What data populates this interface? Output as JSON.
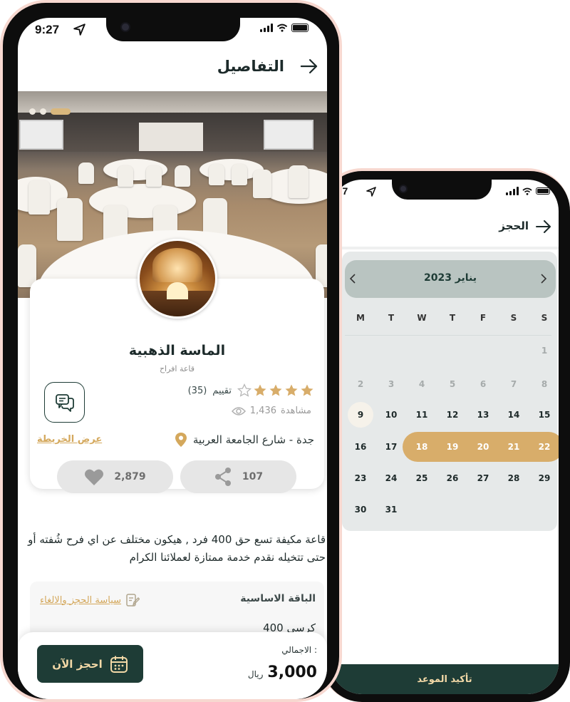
{
  "details_screen": {
    "status_time": "9:27",
    "header_title": "التفاصيل",
    "venue_name": "الماسة الذهبية",
    "venue_type": "قاعة افراح",
    "rating_count": "(35)",
    "rating_label": "تقييم",
    "rating_stars": 4,
    "views": "1,436",
    "views_label": "مشاهدة",
    "location": "جدة - شارع الجامعة العربية",
    "map_link": "عرض الخريطة",
    "likes": "2,879",
    "shares": "107",
    "description": "قاعة مكيفة تسع حق 400 فرد , هيكون مختلف عن اي فرح شُفته أو حتى تتخيله نقدم خدمة ممتازة لعملائنا الكرام",
    "package_title": "الباقة الاساسية",
    "package_policy": "سياسة الحجز والالغاء",
    "package_seats": "400 كرسي",
    "total_label": "الاجمالي :",
    "total_amount": "3,000",
    "currency": "ريال",
    "book_button": "احجز الآن"
  },
  "booking_screen": {
    "status_time": ":27",
    "header_title": "الحجز",
    "month_label": "يناير 2023",
    "weekdays": [
      "M",
      "T",
      "W",
      "T",
      "F",
      "S",
      "S"
    ],
    "weeks": [
      [
        "",
        "",
        "",
        "",
        "",
        "",
        "1"
      ],
      [
        "2",
        "3",
        "4",
        "5",
        "6",
        "7",
        "8"
      ],
      [
        "9",
        "10",
        "11",
        "12",
        "13",
        "14",
        "15"
      ],
      [
        "16",
        "17",
        "18",
        "19",
        "20",
        "21",
        "22"
      ],
      [
        "23",
        "24",
        "25",
        "26",
        "27",
        "28",
        "29"
      ],
      [
        "30",
        "31",
        "",
        "",
        "",
        "",
        ""
      ]
    ],
    "highlighted_day": "9",
    "selected_days": [
      "18",
      "19",
      "20",
      "21",
      "22"
    ],
    "muted_days": [
      "1",
      "2",
      "3",
      "4",
      "5",
      "6",
      "7",
      "8"
    ],
    "confirm_button": "تأكيد الموعد"
  },
  "colors": {
    "primary": "#1e3c36",
    "accent": "#d8ad6a",
    "frame": "#f7d8d0"
  }
}
